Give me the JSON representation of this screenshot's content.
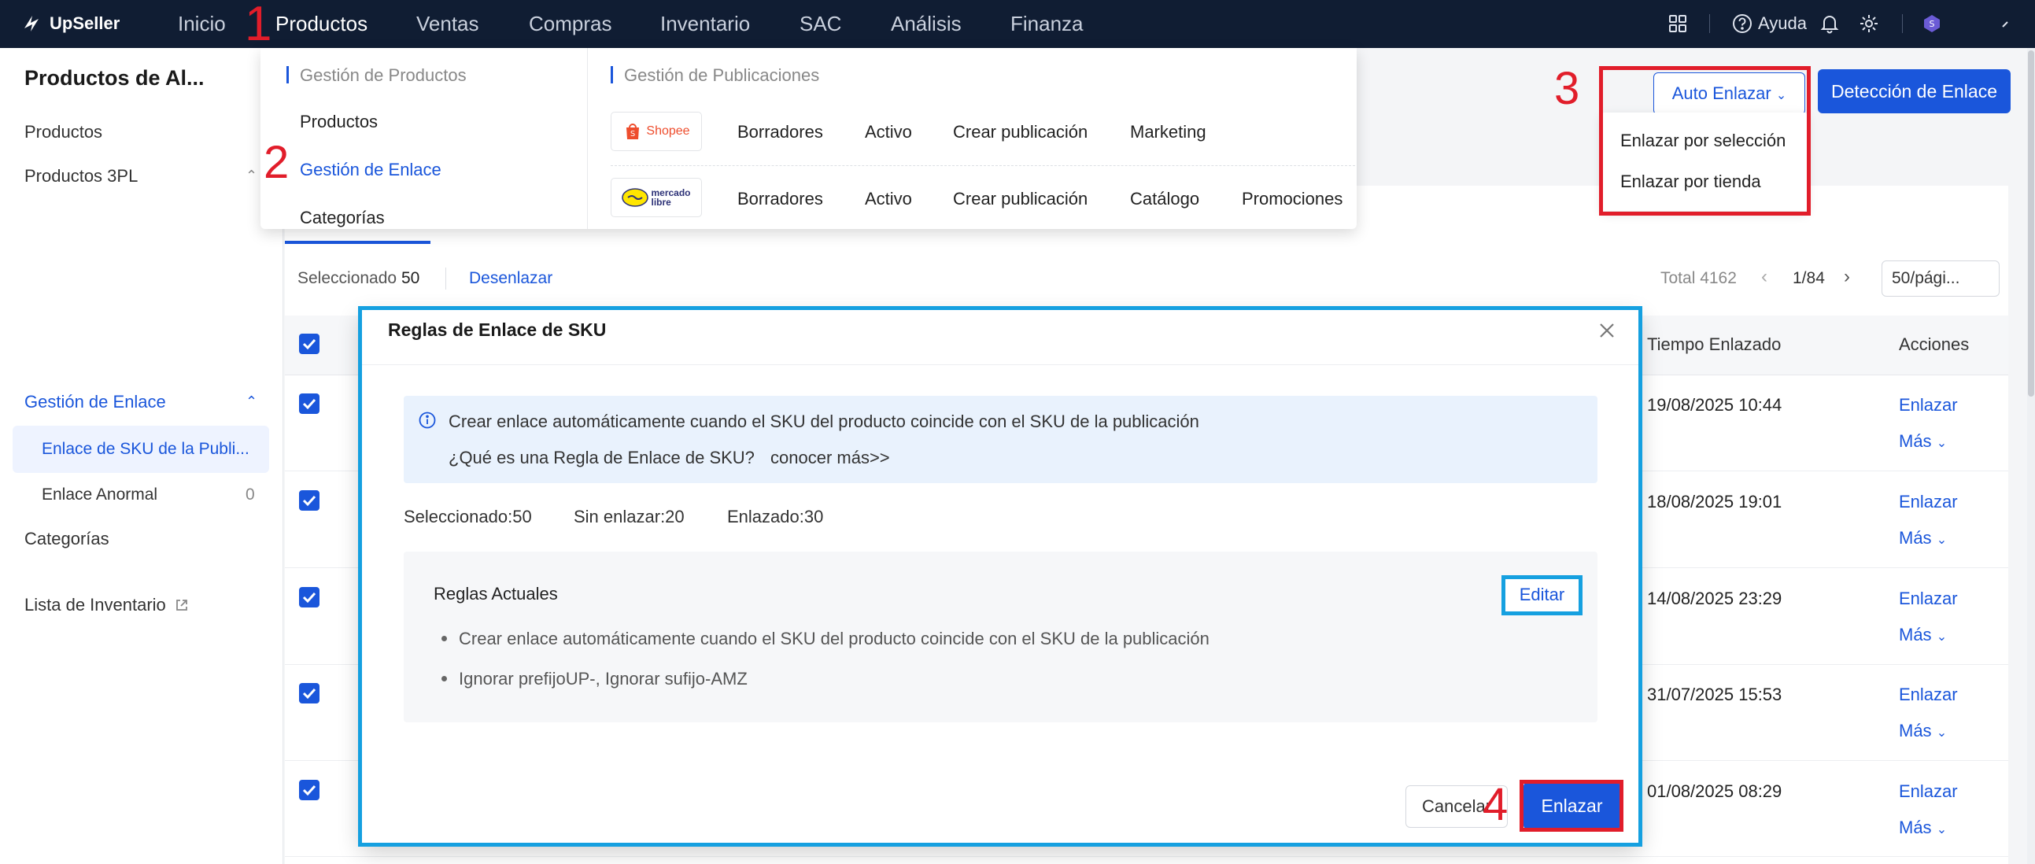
{
  "topbar": {
    "brand": "UpSeller",
    "nav": [
      "Inicio",
      "Productos",
      "Ventas",
      "Compras",
      "Inventario",
      "SAC",
      "Análisis",
      "Finanza"
    ],
    "help_label": "Ayuda"
  },
  "sidebar": {
    "title": "Productos de Al...",
    "items": [
      "Productos",
      "Productos 3PL"
    ],
    "section_link": "Gestión de Enlace",
    "sub_items": [
      {
        "label": "Enlace de SKU de la Publi...",
        "count": ""
      },
      {
        "label": "Enlace Anormal",
        "count": "0"
      }
    ],
    "categories": "Categorías",
    "inventory": "Lista de Inventario"
  },
  "megamenu": {
    "left_header": "Gestión de Productos",
    "left_items": [
      "Productos",
      "Gestión de Enlace",
      "Categorías"
    ],
    "right_header": "Gestión de Publicaciones",
    "shopee": {
      "logo_text": "Shopee",
      "items": [
        "Borradores",
        "Activo",
        "Crear publicación",
        "Marketing"
      ]
    },
    "mercado": {
      "logo_text_1": "mercado",
      "logo_text_2": "libre",
      "items": [
        "Borradores",
        "Activo",
        "Crear publicación",
        "Catálogo",
        "Promociones"
      ]
    }
  },
  "actions": {
    "auto_link": "Auto Enlazar",
    "detect_link": "Detección de Enlace",
    "dropdown": [
      "Enlazar por selección",
      "Enlazar por tienda"
    ]
  },
  "toolbar": {
    "selected_label": "Seleccionado",
    "selected_count": "50",
    "unlink": "Desenlazar",
    "total": "Total 4162",
    "page": "1/84",
    "page_size": "50/pági..."
  },
  "table": {
    "headers": {
      "time": "Tiempo Enlazado",
      "actions": "Acciones"
    },
    "rows": [
      {
        "time": "19/08/2025 10:44"
      },
      {
        "time": "18/08/2025 19:01"
      },
      {
        "time": "14/08/2025 23:29"
      },
      {
        "time": "31/07/2025 15:53"
      },
      {
        "time": "01/08/2025 08:29"
      }
    ],
    "link_action": "Enlazar",
    "more_action": "Más"
  },
  "modal": {
    "title": "Reglas de Enlace de SKU",
    "info_line1": "Crear enlace automáticamente cuando el SKU del producto coincide con el SKU de la publicación",
    "info_line2": "¿Qué es una Regla de Enlace de SKU?",
    "learn_more": "conocer más>>",
    "stats": [
      "Seleccionado:50",
      "Sin enlazar:20",
      "Enlazado:30"
    ],
    "rules_title": "Reglas Actuales",
    "edit": "Editar",
    "rules": [
      "Crear enlace automáticamente cuando el SKU del producto coincide con el SKU de la publicación",
      "Ignorar prefijoUP-, Ignorar sufijo-AMZ"
    ],
    "cancel": "Cancelar",
    "confirm": "Enlazar"
  },
  "annotations": [
    "1",
    "2",
    "3",
    "4"
  ],
  "colors": {
    "primary": "#1a56db",
    "topbar": "#101d33",
    "annotation_red": "#e11d2a",
    "annotation_cyan": "#15a0e0"
  }
}
